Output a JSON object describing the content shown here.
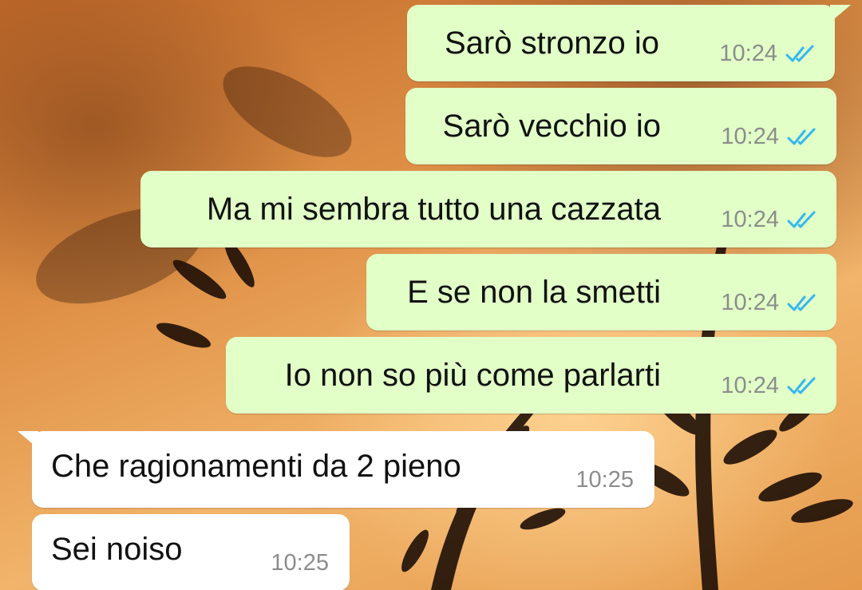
{
  "colors": {
    "outgoing_bubble": "#e1ffc7",
    "incoming_bubble": "#ffffff",
    "read_ticks": "#34b7f1",
    "timestamp": "#8c8c8c"
  },
  "messages": [
    {
      "direction": "outgoing",
      "text": "Sarò stronzo io",
      "time": "10:24",
      "status": "read-double-check-icon"
    },
    {
      "direction": "outgoing",
      "text": "Sarò vecchio io",
      "time": "10:24",
      "status": "read-double-check-icon"
    },
    {
      "direction": "outgoing",
      "text": "Ma mi sembra tutto una cazzata",
      "time": "10:24",
      "status": "read-double-check-icon"
    },
    {
      "direction": "outgoing",
      "text": "E se non la smetti",
      "time": "10:24",
      "status": "read-double-check-icon"
    },
    {
      "direction": "outgoing",
      "text": "Io non so più come parlarti",
      "time": "10:24",
      "status": "read-double-check-icon"
    },
    {
      "direction": "incoming",
      "text": "Che ragionamenti da 2 pieno",
      "time": "10:25"
    },
    {
      "direction": "incoming",
      "text": "Sei noiso",
      "time": "10:25"
    }
  ]
}
